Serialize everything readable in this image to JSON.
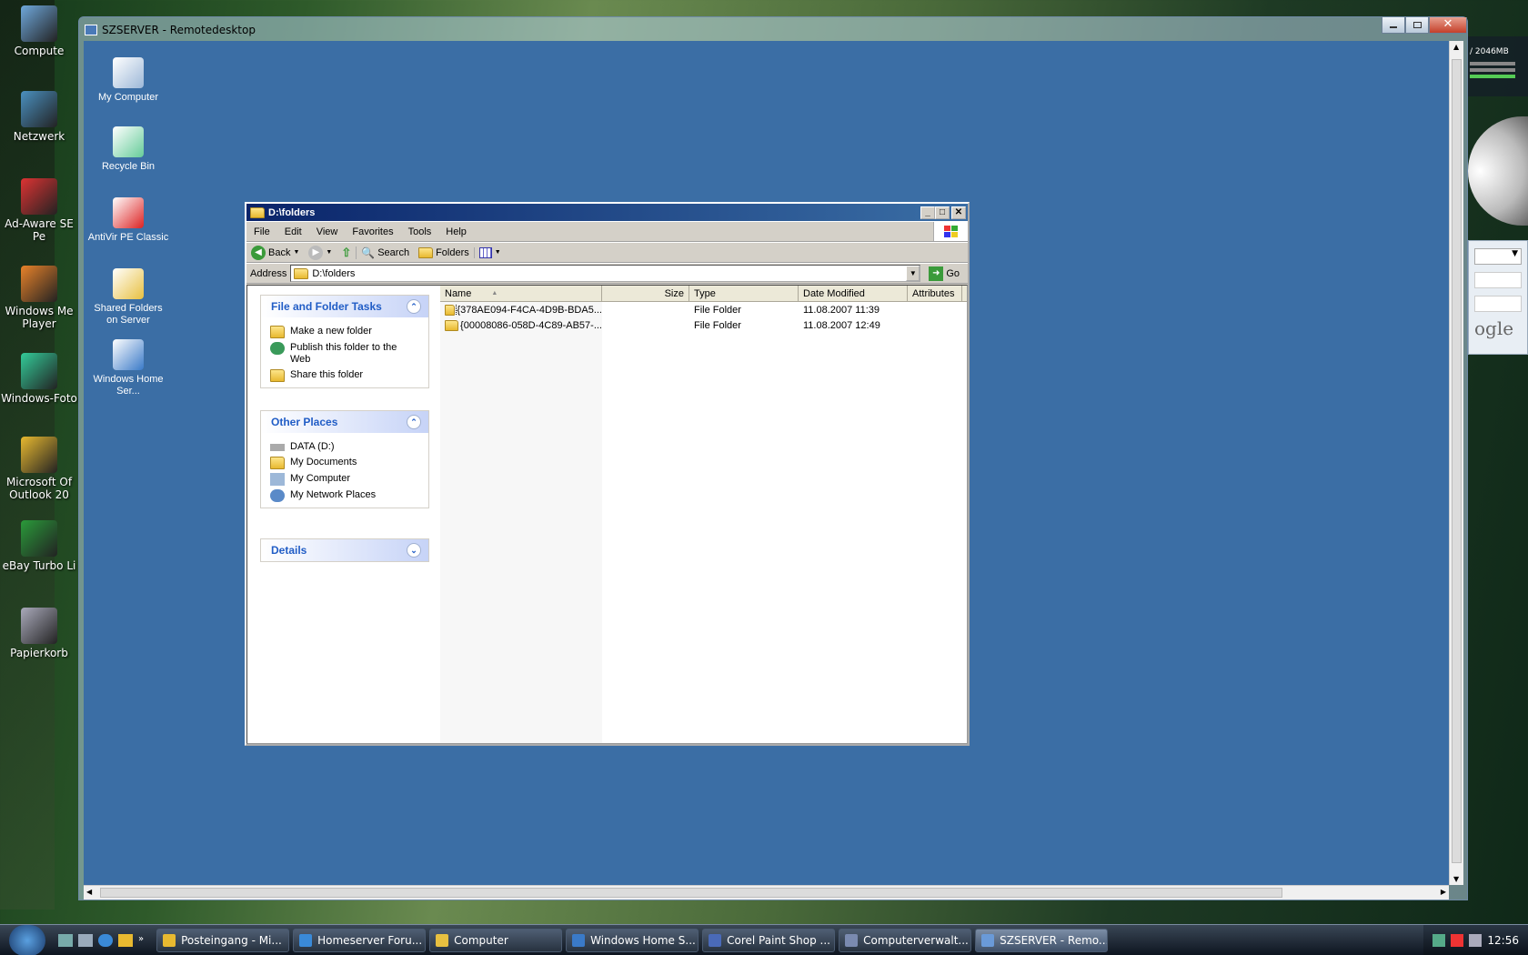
{
  "host_desktop": {
    "icons": [
      {
        "label": "Compute",
        "color": "#6fa8dc"
      },
      {
        "label": "Netzwerk",
        "color": "#4a90c0"
      },
      {
        "label": "Ad-Aware SE Pe",
        "color": "#d33"
      },
      {
        "label": "Windows Me Player",
        "color": "#e8822a"
      },
      {
        "label": "Windows-Foto",
        "color": "#3c9"
      },
      {
        "label": "Microsoft Of Outlook 20",
        "color": "#e8b930"
      },
      {
        "label": "eBay Turbo Li",
        "color": "#2a9a3a"
      },
      {
        "label": "Papierkorb",
        "color": "#aab"
      }
    ]
  },
  "rdp": {
    "title": "SZSERVER - Remotedesktop",
    "desktop_icons": [
      {
        "label": "My Computer",
        "color": "#9db8d8"
      },
      {
        "label": "Recycle Bin",
        "color": "#6c9"
      },
      {
        "label": "AntiVir PE Classic",
        "color": "#d22"
      },
      {
        "label": "Shared Folders on Server",
        "color": "#e8c040"
      },
      {
        "label": "Windows Home Ser...",
        "color": "#3a7ac8"
      }
    ]
  },
  "explorer": {
    "title": "D:\\folders",
    "menu": [
      "File",
      "Edit",
      "View",
      "Favorites",
      "Tools",
      "Help"
    ],
    "toolbar": {
      "back": "Back",
      "search": "Search",
      "folders": "Folders"
    },
    "address_label": "Address",
    "address_value": "D:\\folders",
    "go": "Go",
    "panels": {
      "tasks": {
        "title": "File and Folder Tasks",
        "items": [
          "Make a new folder",
          "Publish this folder to the Web",
          "Share this folder"
        ]
      },
      "places": {
        "title": "Other Places",
        "items": [
          "DATA (D:)",
          "My Documents",
          "My Computer",
          "My Network Places"
        ]
      },
      "details": {
        "title": "Details"
      }
    },
    "columns": [
      "Name",
      "Size",
      "Type",
      "Date Modified",
      "Attributes"
    ],
    "rows": [
      {
        "name": "{378AE094-F4CA-4D9B-BDA5...",
        "size": "",
        "type": "File Folder",
        "date": "11.08.2007 11:39",
        "attr": ""
      },
      {
        "name": "{00008086-058D-4C89-AB57-...",
        "size": "",
        "type": "File Folder",
        "date": "11.08.2007 12:49",
        "attr": ""
      }
    ]
  },
  "gadget": {
    "memory": "/ 2046MB",
    "search_hint": "ogle"
  },
  "taskbar": {
    "items": [
      {
        "label": "Posteingang - Mi...",
        "color": "#e8b930"
      },
      {
        "label": "Homeserver Foru...",
        "color": "#3a8ad8"
      },
      {
        "label": "Computer",
        "color": "#e8c040"
      },
      {
        "label": "Windows Home S...",
        "color": "#3a7ac8"
      },
      {
        "label": "Corel Paint Shop ...",
        "color": "#4a6ab8"
      },
      {
        "label": "Computerverwalt...",
        "color": "#7a8ab0"
      },
      {
        "label": "SZSERVER - Remo...",
        "color": "#6a9ad8"
      }
    ],
    "clock": "12:56"
  }
}
